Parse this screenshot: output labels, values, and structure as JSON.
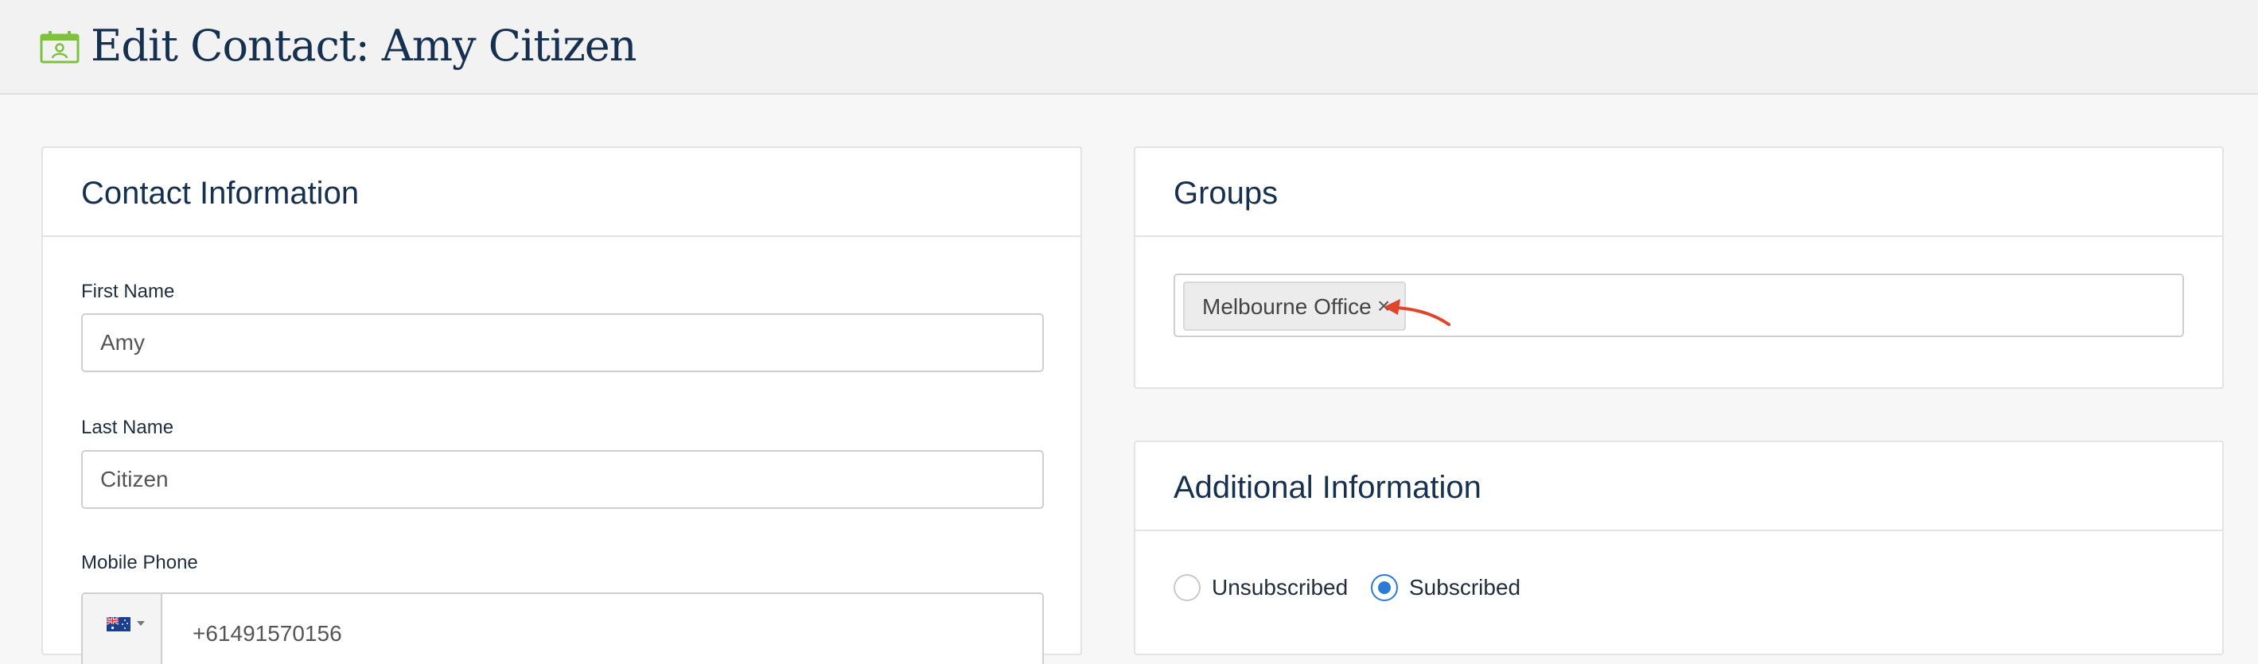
{
  "header": {
    "title": "Edit Contact: Amy Citizen",
    "icon": "contact-card-icon",
    "icon_color": "#7dc13f"
  },
  "contact_info": {
    "title": "Contact Information",
    "first_name": {
      "label": "First Name",
      "value": "Amy"
    },
    "last_name": {
      "label": "Last Name",
      "value": "Citizen"
    },
    "mobile_phone": {
      "label": "Mobile Phone",
      "country_flag": "australia-flag-icon",
      "value": "+61491570156"
    }
  },
  "groups": {
    "title": "Groups",
    "tags": [
      {
        "label": "Melbourne Office",
        "remove_symbol": "×"
      }
    ],
    "annotation": "red-arrow-icon"
  },
  "additional_info": {
    "title": "Additional Information",
    "subscription": {
      "options": [
        "Unsubscribed",
        "Subscribed"
      ],
      "selected": "Subscribed",
      "accent_color": "#2a7ad8"
    }
  }
}
